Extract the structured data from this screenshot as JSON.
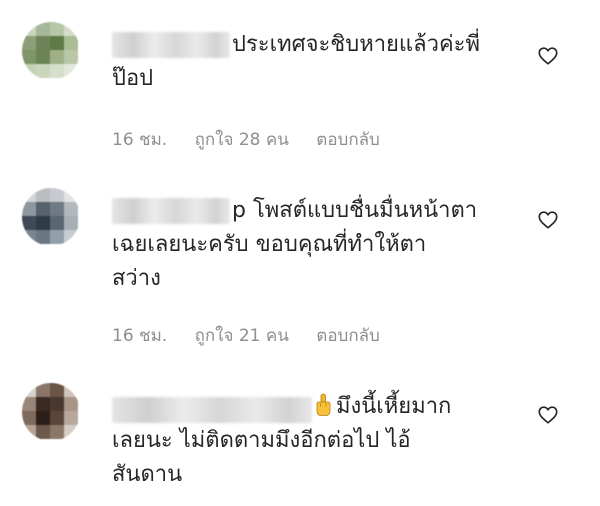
{
  "comments": [
    {
      "text_line1": "ประเทศจะชิบหายแล้วค่ะพี่",
      "text_line2": "ป๊อป",
      "time": "16 ชม.",
      "likes": "ถูกใจ 28 คน",
      "reply": "ตอบกลับ",
      "like_icon": "heart-outline-icon"
    },
    {
      "text_line1": "p โพสต์แบบชื่นมื่นหน้าตา",
      "text_line2": "เฉยเลยนะครับ ขอบคุณที่ทำให้ตา",
      "text_line3": "สว่าง",
      "time": "16 ชม.",
      "likes": "ถูกใจ 21 คน",
      "reply": "ตอบกลับ",
      "like_icon": "heart-outline-icon"
    },
    {
      "emoji": "middle-finger-emoji",
      "text_line1": "มึงนี้เหี้ยมาก",
      "text_line2": "เลยนะ ไม่ติดตามมึงอีกต่อไป ไอ้",
      "text_line3": "สันดาน",
      "like_icon": "heart-outline-icon"
    }
  ],
  "colors": {
    "text": "#262626",
    "meta": "#8e8e8e",
    "background": "#ffffff"
  }
}
